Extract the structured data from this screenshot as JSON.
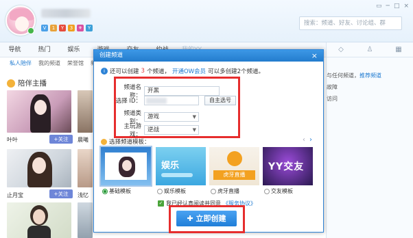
{
  "header": {
    "search_placeholder": "搜索：频道、好友、讨论组、群",
    "badges": [
      "V",
      "1",
      "Y",
      "3",
      "⚜",
      "Y"
    ],
    "win_controls": [
      "▭",
      "─",
      "□",
      "×"
    ]
  },
  "tabs": [
    "导航",
    "热门",
    "娱乐",
    "游戏",
    "交友",
    "约战",
    "我的YY"
  ],
  "subnav": [
    "私人陪伴",
    "我的频道",
    "荣誉馆",
    "新"
  ],
  "section": {
    "title": "陪伴主播"
  },
  "streamers": [
    {
      "name": "叶叶",
      "follow": "+关注"
    },
    {
      "name": "晨曦",
      "follow": ""
    },
    {
      "name": "止月宝",
      "follow": "+关注"
    },
    {
      "name": "浅忆",
      "follow": ""
    }
  ],
  "right_panel": {
    "icons": [
      "◇",
      "♙",
      "▦"
    ],
    "line1_text": "与任何频道，",
    "line1_link": "推荐频道",
    "line2": "故障",
    "line3": "访问"
  },
  "dialog": {
    "title": "创建频道",
    "close": "×",
    "info": {
      "prefix": "还可以创建",
      "count": "3",
      "mid": "个频道，",
      "link": "开通OW会员",
      "suffix": "可以多创建2个频道。"
    },
    "form": {
      "name_label": "频道名称：",
      "name_value": "开黑",
      "id_label": "选择 ID：",
      "id_button": "自主选号",
      "category_label": "频道类别：",
      "category_value": "游戏",
      "game_label": "主玩游戏：",
      "game_value": "逆战"
    },
    "templates": {
      "title": "选择频道模板：",
      "items": [
        {
          "label": "基础模板",
          "selected": true
        },
        {
          "label": "娱乐模板",
          "selected": false
        },
        {
          "label": "虎牙直播",
          "selected": false
        },
        {
          "label": "交友模板",
          "selected": false
        }
      ]
    },
    "agree": {
      "text": "我已经认真阅读并同意",
      "link": "《服务协议》"
    },
    "create_button": "立即创建"
  }
}
